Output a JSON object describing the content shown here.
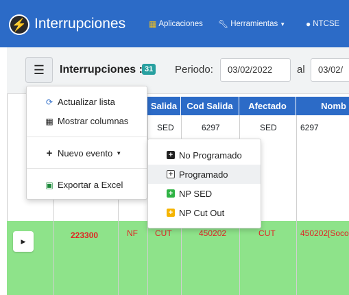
{
  "navbar": {
    "title": "Interrupciones",
    "items": [
      {
        "label": "Aplicaciones",
        "icon": "grid-icon"
      },
      {
        "label": "Herramientas",
        "icon": "wrench-icon"
      },
      {
        "label": "NTCSE",
        "icon": "users-icon"
      }
    ]
  },
  "toolbar": {
    "title": "Interrupciones :",
    "count": "31",
    "period_label": "Periodo:",
    "date_from": "03/02/2022",
    "al_label": "al",
    "date_to": "03/02/"
  },
  "table": {
    "headers": [
      "Salida",
      "Cod Salida",
      "Afectado",
      "Nomb"
    ],
    "row1": {
      "salida": "SED",
      "cod_salida": "6297",
      "afectado": "SED",
      "nombre": "6297"
    },
    "row2": {
      "id": "223300",
      "tipo": "NF",
      "salida": "CUT",
      "cod_salida": "450202",
      "afectado": "CUT",
      "nombre": "450202[Soco"
    }
  },
  "menu": {
    "refresh": "Actualizar lista",
    "columns": "Mostrar columnas",
    "new_event": "Nuevo evento",
    "export": "Exportar a Excel"
  },
  "submenu": {
    "items": [
      {
        "label": "No Programado",
        "icon": "square-plus-dark-icon"
      },
      {
        "label": "Programado",
        "icon": "square-plus-outline-icon"
      },
      {
        "label": "NP SED",
        "icon": "square-plus-green-icon"
      },
      {
        "label": "NP Cut Out",
        "icon": "square-plus-yellow-icon"
      }
    ]
  },
  "colors": {
    "primary": "#2c6bc7",
    "row_green": "#8ee38a",
    "red_text": "#e02424",
    "badge": "#28a0a0"
  }
}
